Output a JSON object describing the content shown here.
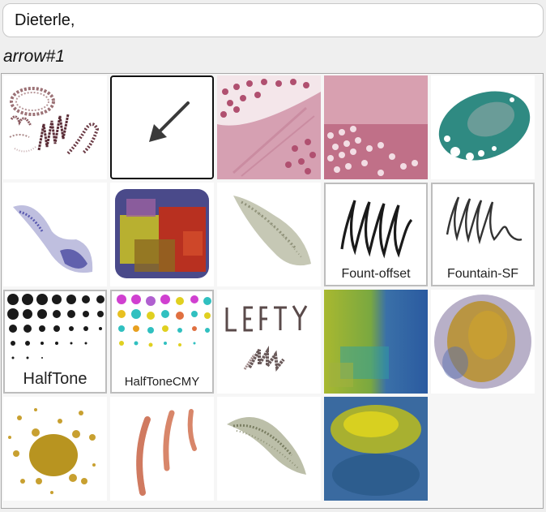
{
  "search": {
    "value": "Dieterle,"
  },
  "selected_brush": {
    "name": "arrow#1"
  },
  "brushes": [
    {
      "name": "brush-scribble-circle",
      "caption": ""
    },
    {
      "name": "brush-arrow",
      "caption": ""
    },
    {
      "name": "brush-pink-dots",
      "caption": ""
    },
    {
      "name": "brush-mauve-grid",
      "caption": ""
    },
    {
      "name": "brush-teal-splatter",
      "caption": ""
    },
    {
      "name": "brush-blue-spray",
      "caption": ""
    },
    {
      "name": "brush-multicolor-block",
      "caption": ""
    },
    {
      "name": "brush-grey-spray",
      "caption": ""
    },
    {
      "name": "brush-fount-offset",
      "caption": "Fount-offset"
    },
    {
      "name": "brush-fountain-sf",
      "caption": "Fountain-SF"
    },
    {
      "name": "brush-halftone",
      "caption": "HalfTone"
    },
    {
      "name": "brush-halftone-cmy",
      "caption": "HalfToneCMY"
    },
    {
      "name": "brush-lefty",
      "caption": ""
    },
    {
      "name": "brush-green-blue-gradient",
      "caption": ""
    },
    {
      "name": "brush-ochre-blend",
      "caption": ""
    },
    {
      "name": "brush-gold-splatter",
      "caption": ""
    },
    {
      "name": "brush-salmon-strokes",
      "caption": ""
    },
    {
      "name": "brush-olive-stroke",
      "caption": ""
    },
    {
      "name": "brush-yellow-blue-blend",
      "caption": ""
    }
  ],
  "icons": {
    "selected_tile_icon": "arrow-icon"
  },
  "colors": {
    "selection_border": "#111111",
    "panel_background": "#f6f6f6"
  }
}
